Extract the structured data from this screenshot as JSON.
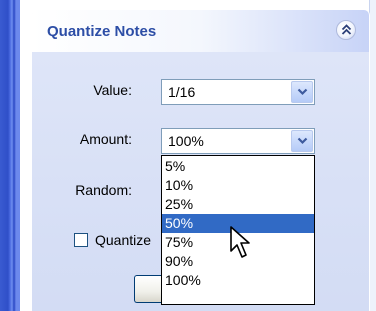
{
  "panel": {
    "title": "Quantize Notes",
    "collapse_icon": "chevron-up-double-icon"
  },
  "value_field": {
    "label": "Value:",
    "selected": "1/16"
  },
  "amount_field": {
    "label": "Amount:",
    "selected": "100%",
    "options": [
      "5%",
      "10%",
      "25%",
      "50%",
      "75%",
      "90%",
      "100%"
    ],
    "highlighted": "50%"
  },
  "random_field": {
    "label": "Random:"
  },
  "checkbox": {
    "label": "Quantize",
    "checked": false
  },
  "colors": {
    "title": "#2d4ea6",
    "highlight": "#316ac5",
    "border": "#7f9db9"
  }
}
